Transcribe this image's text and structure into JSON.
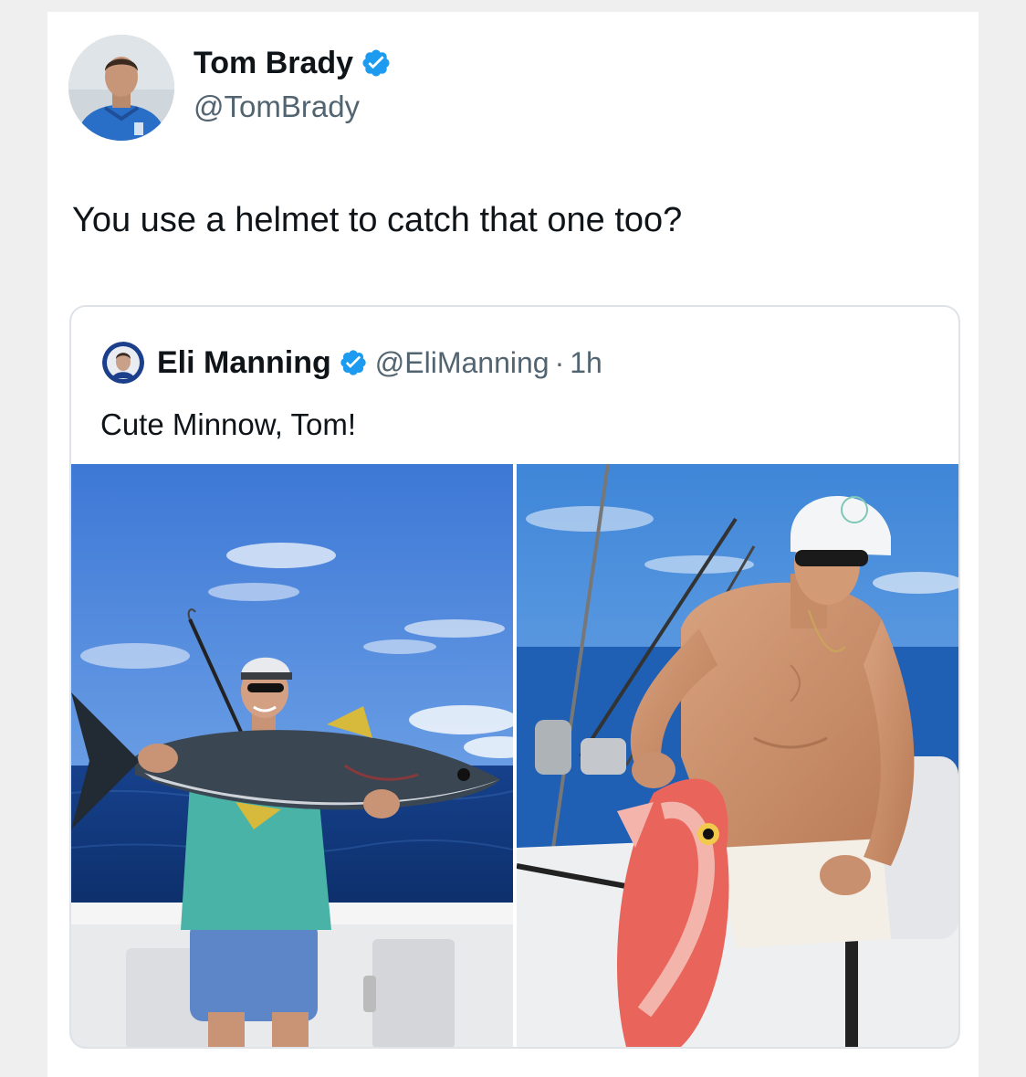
{
  "tweet": {
    "author": {
      "name": "Tom Brady",
      "handle": "@TomBrady",
      "verified": true,
      "avatar_icon": "profile-photo"
    },
    "text": "You use a helmet to catch that one too?",
    "quoted": {
      "author": {
        "name": "Eli Manning",
        "handle": "@EliManning",
        "verified": true,
        "avatar_icon": "profile-photo"
      },
      "separator": "·",
      "time": "1h",
      "text": "Cute Minnow, Tom!",
      "media": [
        {
          "kind": "photo",
          "icon": "photo-man-holding-tuna"
        },
        {
          "kind": "photo",
          "icon": "photo-man-holding-red-snapper"
        }
      ]
    }
  },
  "colors": {
    "verified_blue": "#1d9bf0",
    "text_primary": "#0f1419",
    "text_secondary": "#536471",
    "border": "#dfe3e7"
  }
}
